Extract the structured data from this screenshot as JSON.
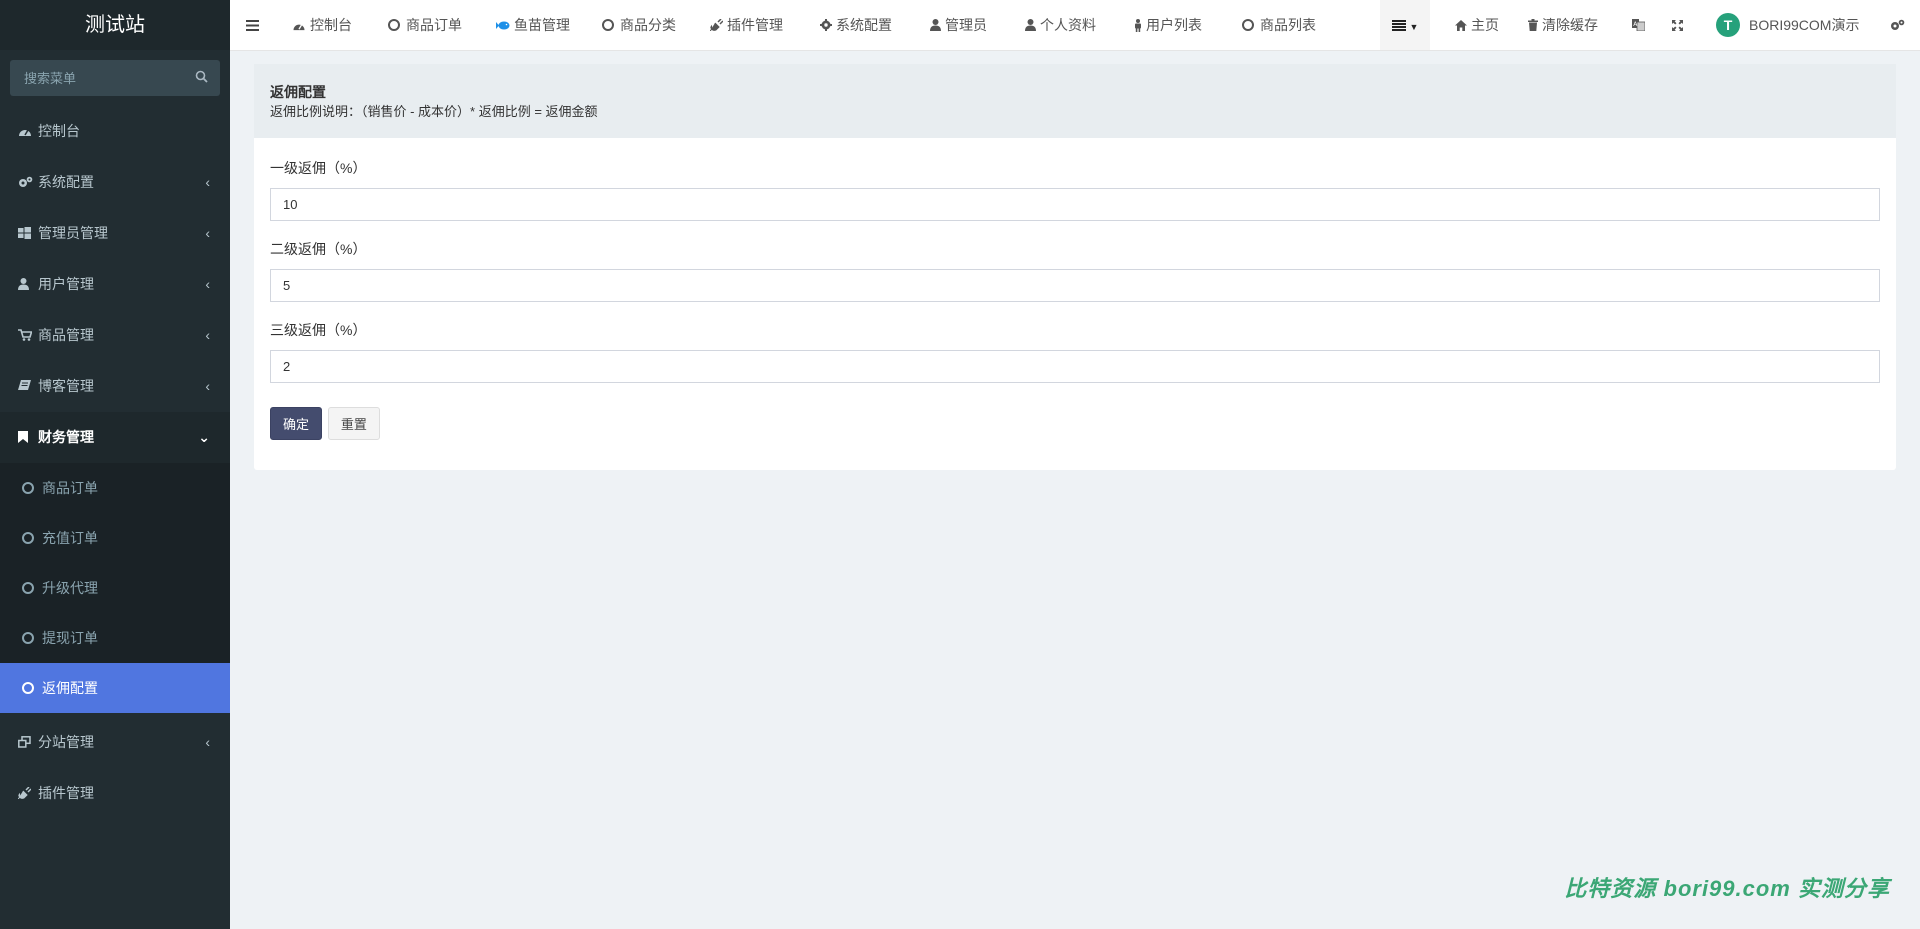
{
  "sidebar": {
    "brand": "测试站",
    "search_placeholder": "搜索菜单",
    "items": [
      {
        "label": "控制台"
      },
      {
        "label": "系统配置"
      },
      {
        "label": "管理员管理"
      },
      {
        "label": "用户管理"
      },
      {
        "label": "商品管理"
      },
      {
        "label": "博客管理"
      },
      {
        "label": "财务管理"
      },
      {
        "label": "分站管理"
      },
      {
        "label": "插件管理"
      }
    ],
    "sub_items": [
      {
        "label": "商品订单"
      },
      {
        "label": "充值订单"
      },
      {
        "label": "升级代理"
      },
      {
        "label": "提现订单"
      },
      {
        "label": "返佣配置"
      }
    ]
  },
  "topbar": {
    "tabs": [
      {
        "label": "控制台"
      },
      {
        "label": "商品订单"
      },
      {
        "label": "鱼苗管理"
      },
      {
        "label": "商品分类"
      },
      {
        "label": "插件管理"
      },
      {
        "label": "系统配置"
      },
      {
        "label": "管理员"
      },
      {
        "label": "个人资料"
      },
      {
        "label": "用户列表"
      },
      {
        "label": "商品列表"
      }
    ],
    "home_label": "主页",
    "clear_cache_label": "清除缓存",
    "avatar_letter": "T",
    "user_name": "BORI99COM演示"
  },
  "panel": {
    "title": "返佣配置",
    "description": "返佣比例说明：（销售价 - 成本价）* 返佣比例 = 返佣金额",
    "fields": [
      {
        "label": "一级返佣（%）",
        "value": "10"
      },
      {
        "label": "二级返佣（%）",
        "value": "5"
      },
      {
        "label": "三级返佣（%）",
        "value": "2"
      }
    ],
    "submit_label": "确定",
    "reset_label": "重置"
  },
  "watermark": "比特资源  bori99.com  实测分享",
  "colors": {
    "sidebar_bg": "#222d32",
    "active_item": "#5076e0",
    "primary_button": "#444c6e",
    "avatar_bg": "#26a17b",
    "watermark": "#3ba775"
  }
}
